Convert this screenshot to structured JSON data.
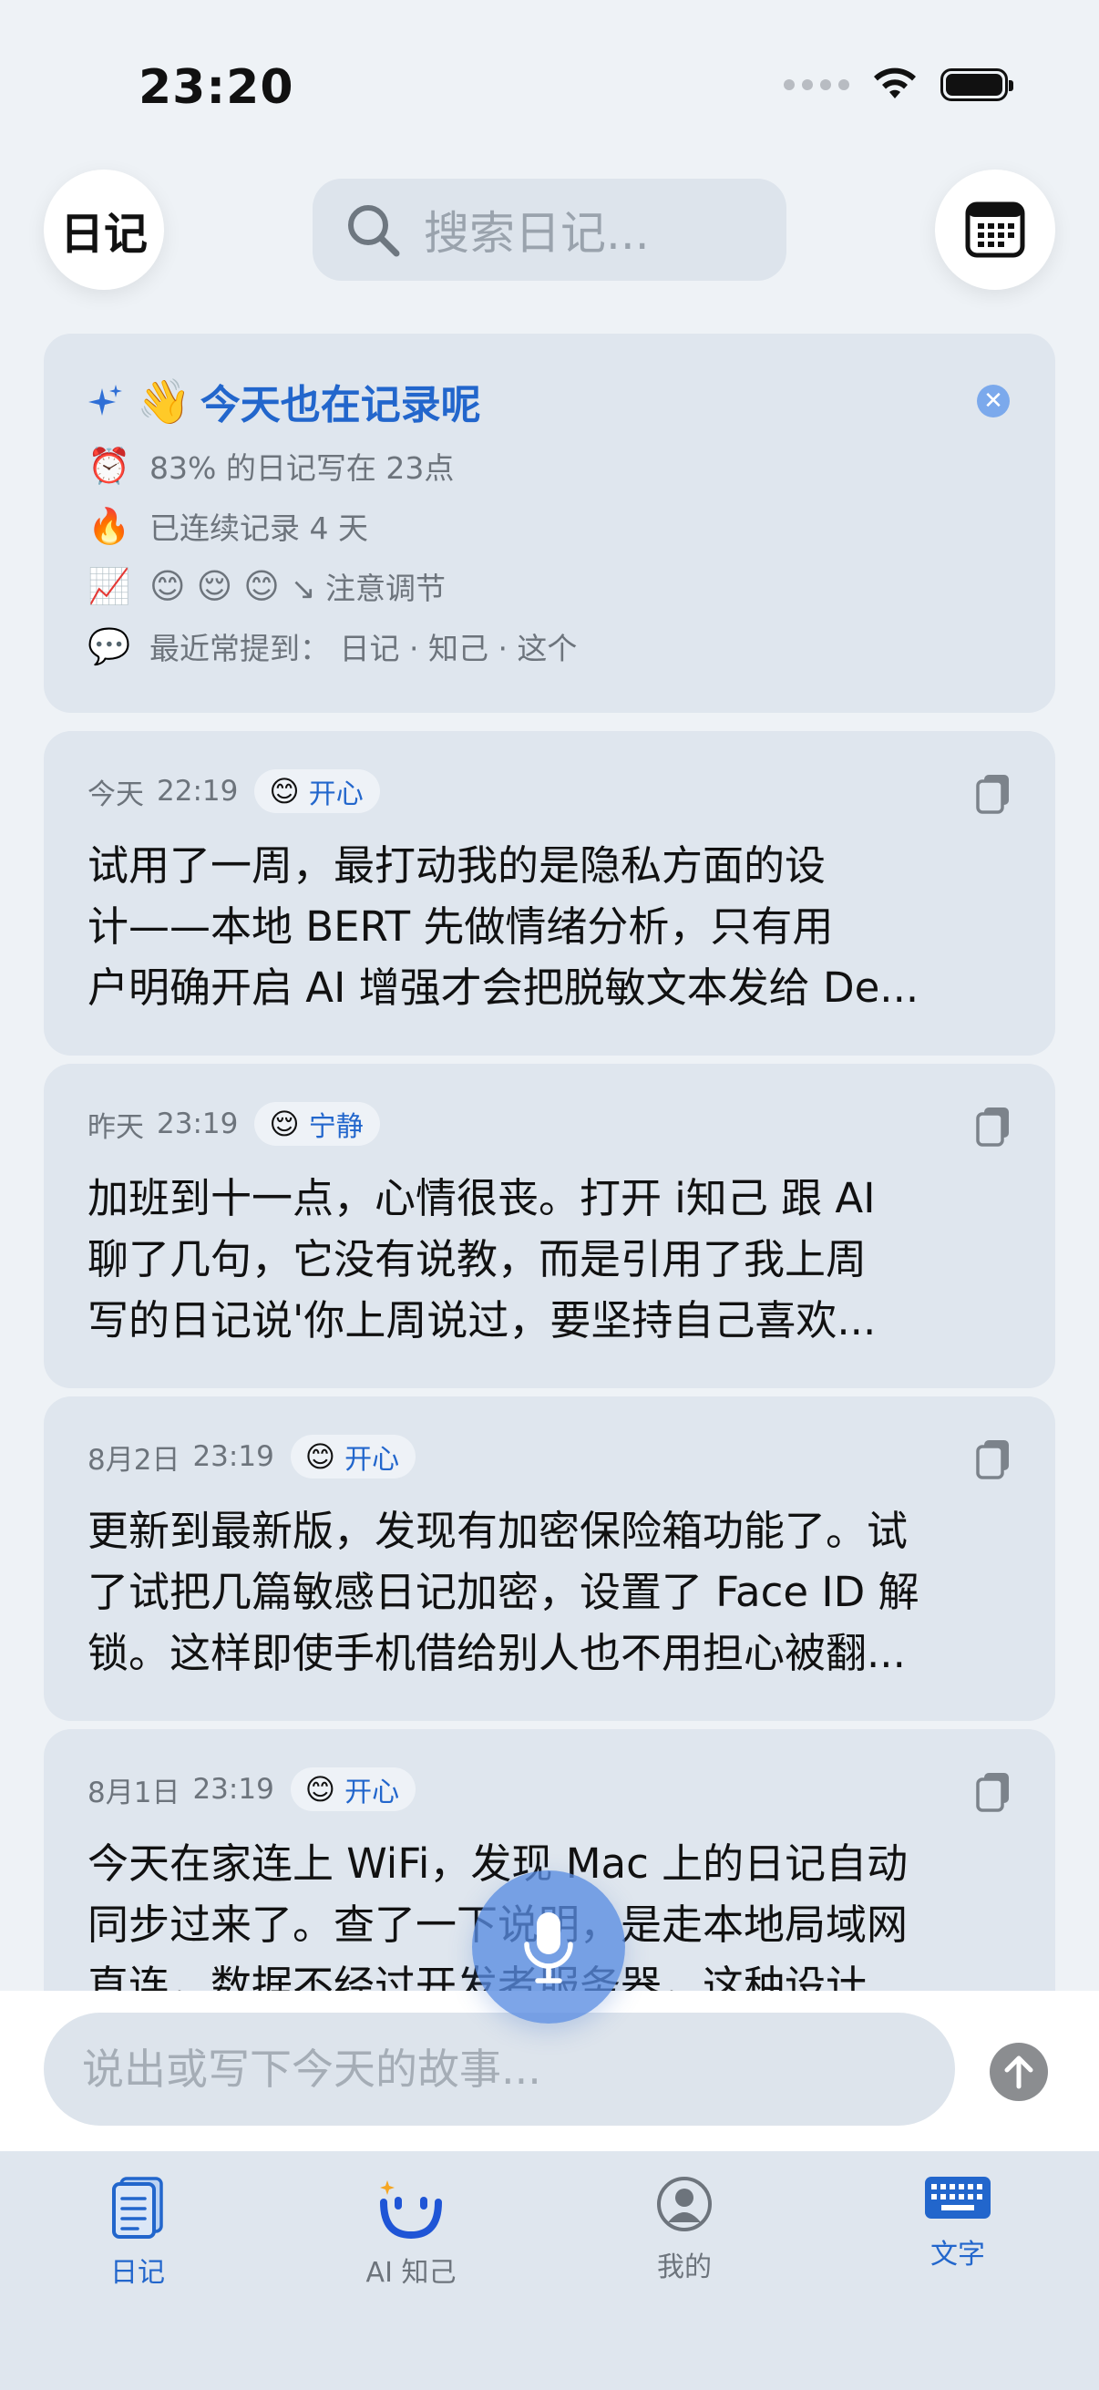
{
  "status": {
    "time": "23:20"
  },
  "header": {
    "diary_button": "日记",
    "search_placeholder": "搜索日记..."
  },
  "summary": {
    "title": "今天也在记录呢",
    "wave_emoji": "👋",
    "stats": [
      {
        "icon": "⏰",
        "text": "83% 的日记写在 23点"
      },
      {
        "icon": "🔥",
        "text": "已连续记录 4 天"
      },
      {
        "icon": "📈",
        "moods": [
          "😊",
          "😌",
          "😊"
        ],
        "text": "↘ 注意调节"
      },
      {
        "icon": "💬",
        "text": "最近常提到：  日记 · 知己 · 这个"
      }
    ]
  },
  "entries": [
    {
      "date": "今天",
      "time": "22:19",
      "mood_emoji": "😊",
      "mood": "开心",
      "lines": [
        "试用了一周，最打动我的是隐私方面的设",
        "计——本地 BERT 先做情绪分析，只有用",
        "户明确开启 AI 增强才会把脱敏文本发给 De..."
      ]
    },
    {
      "date": "昨天",
      "time": "23:19",
      "mood_emoji": "😌",
      "mood": "宁静",
      "lines": [
        "加班到十一点，心情很丧。打开 i知己 跟 AI",
        "聊了几句，它没有说教，而是引用了我上周",
        "写的日记说'你上周说过，要坚持自己喜欢..."
      ]
    },
    {
      "date": "8月2日",
      "time": "23:19",
      "mood_emoji": "😊",
      "mood": "开心",
      "lines": [
        "更新到最新版，发现有加密保险箱功能了。试",
        "了试把几篇敏感日记加密，设置了 Face ID 解",
        "锁。这样即使手机借给别人也不用担心被翻..."
      ]
    },
    {
      "date": "8月1日",
      "time": "23:19",
      "mood_emoji": "😊",
      "mood": "开心",
      "lines": [
        "今天在家连上 WiFi，发现 Mac 上的日记自动",
        "同步过来了。查了一下说明，是走本地局域网",
        "直连，数据不经过开发者服务器，这种设计..."
      ]
    }
  ],
  "composer": {
    "placeholder": "说出或写下今天的故事..."
  },
  "tabs": [
    {
      "label": "日记",
      "icon": "diary-icon",
      "active": true
    },
    {
      "label": "AI 知己",
      "icon": "ai-friend-icon",
      "active": false
    },
    {
      "label": "我的",
      "icon": "profile-icon",
      "active": false
    },
    {
      "label": "文字",
      "icon": "keyboard-icon",
      "active": true
    }
  ],
  "colors": {
    "accent": "#2266cc",
    "background": "#eef2f6",
    "card": "#dfe6ee"
  }
}
